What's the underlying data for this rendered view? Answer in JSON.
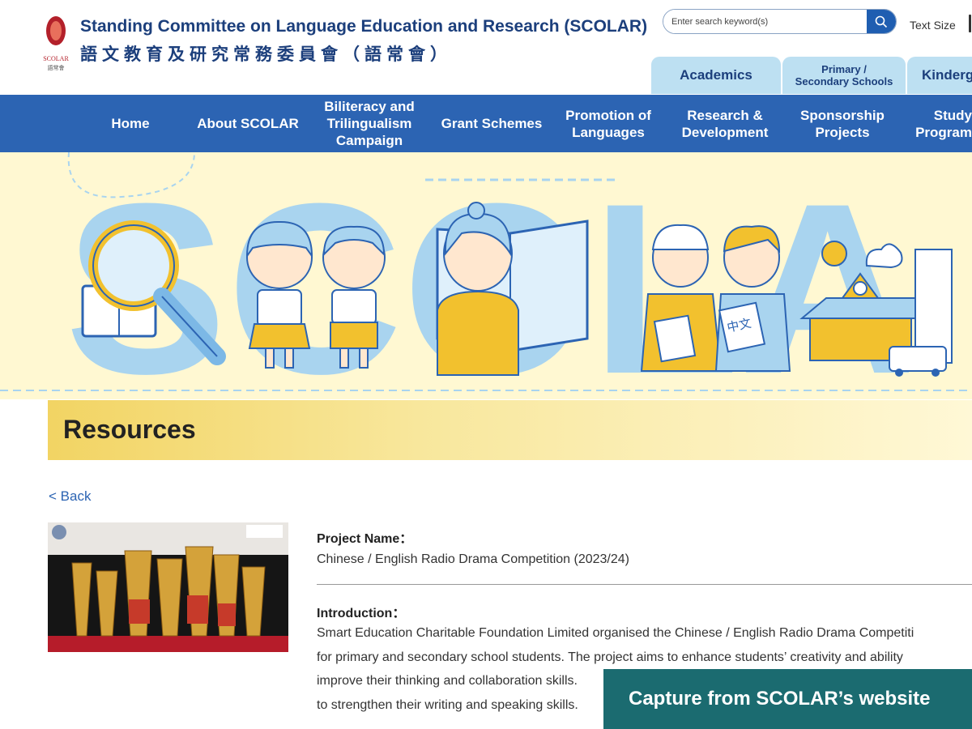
{
  "header": {
    "logo_text": "SCOLAR",
    "logo_subtext": "語常會",
    "title_en": "Standing Committee on Language Education and Research (SCOLAR)",
    "title_zh": "語文教育及研究常務委員會（語常會）",
    "search_placeholder": "Enter search keyword(s)",
    "search_icon": "search-icon",
    "text_size_label": "Text Size",
    "tabs": [
      {
        "label": "Academics"
      },
      {
        "label_line1": "Primary /",
        "label_line2": "Secondary Schools"
      },
      {
        "label": "Kinderg"
      }
    ]
  },
  "nav": {
    "items": [
      {
        "label": "Home"
      },
      {
        "label": "About SCOLAR"
      },
      {
        "line1": "Biliteracy and",
        "line2": "Trilingualism",
        "line3": "Campaign"
      },
      {
        "label": "Grant Schemes"
      },
      {
        "line1": "Promotion of",
        "line2": "Languages"
      },
      {
        "line1": "Research &",
        "line2": "Development"
      },
      {
        "line1": "Sponsorship",
        "line2": "Projects"
      },
      {
        "line1": "Study",
        "line2": "Program"
      }
    ]
  },
  "banner": {
    "book_label": "中文"
  },
  "resources": {
    "title": "Resources",
    "back_label": "< Back",
    "project_name_label": "Project Name：",
    "project_name_value": "Chinese / English Radio Drama Competition (2023/24)",
    "introduction_label": "Introduction：",
    "introduction_lines": [
      "Smart Education Charitable Foundation Limited organised the Chinese / English Radio Drama Competiti",
      "for primary and secondary school students. The project aims to enhance students’ creativity and ability",
      "improve their thinking and collaboration skills.",
      "to strengthen their writing and speaking skills."
    ]
  },
  "caption": "Capture from SCOLAR’s website",
  "colors": {
    "nav_blue": "#2c64b3",
    "title_navy": "#1c3f7c",
    "tab_light_blue": "#bde0f2",
    "banner_cream": "#fff8d2",
    "resources_yellow": "#f2d463",
    "caption_teal": "#1b6b70"
  }
}
